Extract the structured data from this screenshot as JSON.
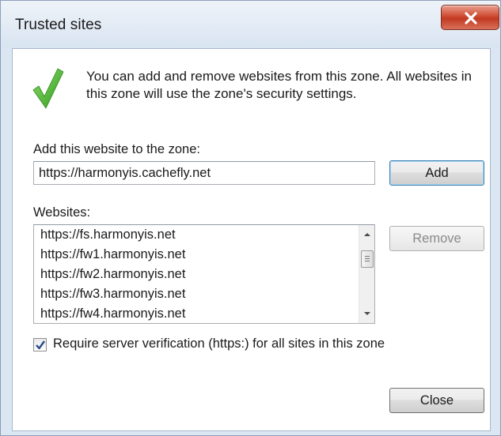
{
  "window": {
    "title": "Trusted sites",
    "close_label": "Close window"
  },
  "info": {
    "icon": "checkmark-icon",
    "text": "You can add and remove websites from this zone. All websites in this zone will use the zone's security settings."
  },
  "add_section": {
    "label": "Add this website to the zone:",
    "url_value": "https://harmonyis.cachefly.net",
    "add_button": "Add"
  },
  "websites": {
    "label": "Websites:",
    "items": [
      "https://fs.harmonyis.net",
      "https://fw1.harmonyis.net",
      "https://fw2.harmonyis.net",
      "https://fw3.harmonyis.net",
      "https://fw4.harmonyis.net"
    ],
    "remove_button": "Remove"
  },
  "require_https": {
    "label": "Require server verification (https:) for all sites in this zone",
    "checked": true
  },
  "footer": {
    "close_button": "Close"
  },
  "colors": {
    "check_green": "#4caf35",
    "close_red": "#c23a22",
    "frame": "#dbe6f3"
  }
}
